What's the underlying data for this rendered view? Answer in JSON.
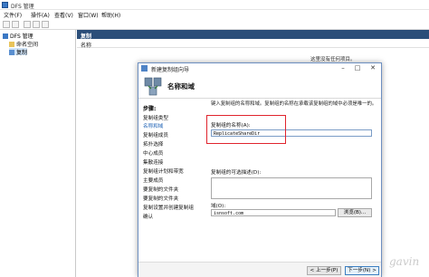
{
  "window": {
    "title": "DFS 管理"
  },
  "menu": [
    "文件(F)",
    "操作(A)",
    "查看(V)",
    "窗口(W)",
    "帮助(H)"
  ],
  "tree": [
    {
      "label": "DFS 管理",
      "icon": "dfs-icon"
    },
    {
      "label": "命名空间",
      "icon": "folder-icon"
    },
    {
      "label": "复制",
      "icon": "replication-icon"
    }
  ],
  "main": {
    "header": "复制",
    "column_name": "名称",
    "empty_text": "这里没有任何项目。"
  },
  "wizard": {
    "title": "新建复制组向导",
    "heading": "名称和域",
    "steps_title": "步骤:",
    "steps": [
      "复制组类型",
      "名称和域",
      "复制组成员",
      "拓扑选择",
      "中心成员",
      "集散连接",
      "复制组计划和带宽",
      "主要成员",
      "要复制的文件夹",
      "要复制的文件夹",
      "复制设置并创建复制组",
      "确认"
    ],
    "description": "键入复制组的名称和域。复制组的名称在承载该复制组的域中必须是唯一的。",
    "name_label": "复制组的名称(A):",
    "name_value": "ReplicateShareDir",
    "optional_label": "复制组的可选描述(D):",
    "domain_label": "域(O):",
    "domain_value": "isnsoft.com",
    "browse_label": "浏览(B)...",
    "back_label": "< 上一步(P)",
    "next_label": "下一步(N) >"
  },
  "watermark": "gavin",
  "colors": {
    "accent": "#2b4e79",
    "highlight": "#e0242d"
  }
}
